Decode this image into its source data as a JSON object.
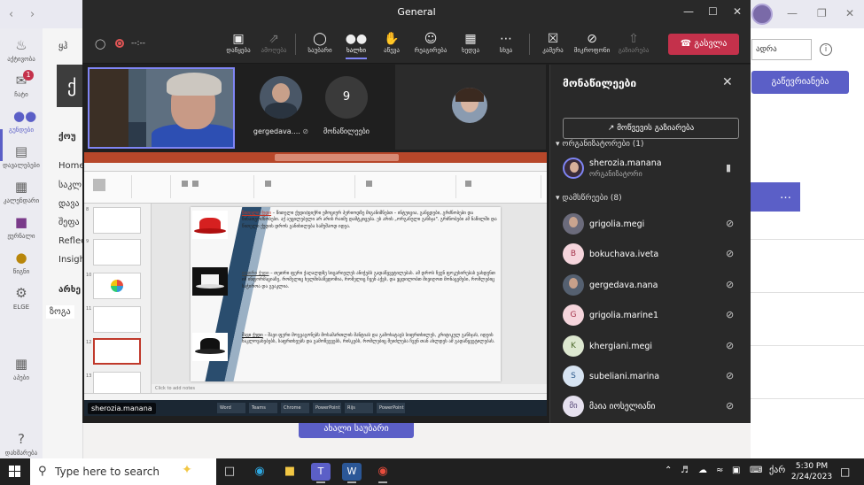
{
  "window": {
    "title": "General"
  },
  "rail": {
    "items": [
      {
        "label": "აქტივობა",
        "icon": "bell-icon"
      },
      {
        "label": "ჩატი",
        "icon": "chat-icon",
        "badge": "1"
      },
      {
        "label": "გუნდები",
        "icon": "teams-icon",
        "active": true
      },
      {
        "label": "დავალებები",
        "icon": "assignments-icon"
      },
      {
        "label": "კალენდარი",
        "icon": "calendar-icon"
      },
      {
        "label": "ჟურნალი",
        "icon": "journal-icon"
      },
      {
        "label": "წიგნი",
        "icon": "book-icon"
      },
      {
        "label": "ELGE",
        "icon": "elge-icon"
      },
      {
        "label": "აპები",
        "icon": "apps-icon"
      },
      {
        "label": "დახმარება",
        "icon": "help-icon"
      }
    ]
  },
  "team_panel": {
    "tile_letter": "ქ",
    "items": [
      "ყჰ",
      "ქოუ",
      "Home",
      "საკლ",
      "დავა",
      "შეფა",
      "Reflec",
      "Insigh",
      "არხე",
      "ზოგა"
    ]
  },
  "bg_right": {
    "mark_button": "გაწევრიანება",
    "pill_label": "ადრა"
  },
  "bg_new_conversation": "ახალი საუბარი",
  "meeting": {
    "timer": "--:--",
    "toolbar": [
      {
        "label": "დაწყება",
        "icon": "share-tray-icon"
      },
      {
        "label": "ამოღება",
        "icon": "pop-out-icon",
        "dim": true
      },
      {
        "label": "საუბარი",
        "icon": "chat-bubble-icon"
      },
      {
        "label": "ხალხი",
        "icon": "people-icon",
        "active": true
      },
      {
        "label": "აწევა",
        "icon": "raise-hand-icon"
      },
      {
        "label": "რეაგირება",
        "icon": "react-icon"
      },
      {
        "label": "ხედვა",
        "icon": "view-grid-icon"
      },
      {
        "label": "სხვა",
        "icon": "more-icon"
      },
      {
        "label": "კამერა",
        "icon": "camera-off-icon"
      },
      {
        "label": "მიკროფონი",
        "icon": "mic-off-icon"
      },
      {
        "label": "გაზიარება",
        "icon": "share-screen-icon",
        "dim": true
      }
    ],
    "leave_label": "გასვლა",
    "gallery": {
      "person_name": "gergedava....",
      "count_value": "9",
      "count_label": "მონაწილეები"
    },
    "presenter": "sherozia.manana",
    "notes_placeholder": "Click to add notes",
    "slide_paragraphs": [
      {
        "title": "წითელი ქუდი",
        "text": " – წითელი ქუდი/ფიქრი ემოციურ პერიოდზე მიგანიშნებთ – ინტუიცია, განცდები, გრძნობები და წინათგრძნობები. აქ აუცილებელი არ არის რაიმე დამტკიცება. ეს არის „ორგანული განსჯა\". გრძნობები ამ ნაწილში და წითელი ქუდის დროს განიხილება სამუშაოდ იდეა."
      },
      {
        "title": "თეთრი ქუდი",
        "text": " – თეთრი ფერი ქაღალდზე სიცარიელეს ანიჭებს გადაწყვეტილებას. ამ დროს ჩვენ ფოკუსირებას ვახდენთ იმ ინფორმაციაზე, რომელიც ხელმისაწვდომია, რომელიც ჩვენ აქვს, და ვცდილობთ მივიღოთ მონაცემები, რომლებიც საჭიროა და გვაკლია."
      },
      {
        "title": "შავი ქუდი",
        "text": " – შავი ფერი მოგვაგონებს მოსამართლის მანტიას და გამოხატავს სიფრთხილეს, კრიტიკულ განსჯას, იდეის ნაკლოვანებებს, საფრთხეებს და გამოწვევებს, რისკებს, რომლებიც შეიძლება ჩვენ თან ახლდეს ამ გადაწყვეტილებას."
      }
    ],
    "slide_numbers": [
      "8",
      "9",
      "10",
      "11",
      "12",
      "13"
    ],
    "task_apps": [
      "Word",
      "Teams",
      "Chrome",
      "PowerPoint",
      "Rijs Express",
      "PowerPoint"
    ]
  },
  "participants": {
    "title": "მონაწილეები",
    "share_invite": "მოწვევის გაზიარება",
    "organizers_header": "ორგანიზატორები (1)",
    "attendees_header": "დამსწრეები (8)",
    "organizer": {
      "name": "sherozia.manana",
      "role": "ორგანიზატორი"
    },
    "attendees": [
      {
        "name": "grigolia.megi",
        "initials": "",
        "color": "#6b6b7b"
      },
      {
        "name": "bokuchava.iveta",
        "initials": "B",
        "color": "#f5d5dc"
      },
      {
        "name": "gergedava.nana",
        "initials": "",
        "color": "#556070"
      },
      {
        "name": "grigolia.marine1",
        "initials": "G",
        "color": "#f5d5dc"
      },
      {
        "name": "khergiani.megi",
        "initials": "K",
        "color": "#dde8d0"
      },
      {
        "name": "subeliani.marina",
        "initials": "S",
        "color": "#d7e4f2"
      },
      {
        "name": "მაია იოსელიანი",
        "initials": "მი",
        "color": "#e6e1ef"
      }
    ]
  },
  "taskbar": {
    "search_placeholder": "Type here to search",
    "time": "5:30 PM",
    "date": "2/24/2023",
    "lang": "ქარ"
  },
  "colors": {
    "accent": "#5b5fc7",
    "leave": "#c4314b",
    "meeting_bg": "#1f1f1f"
  }
}
